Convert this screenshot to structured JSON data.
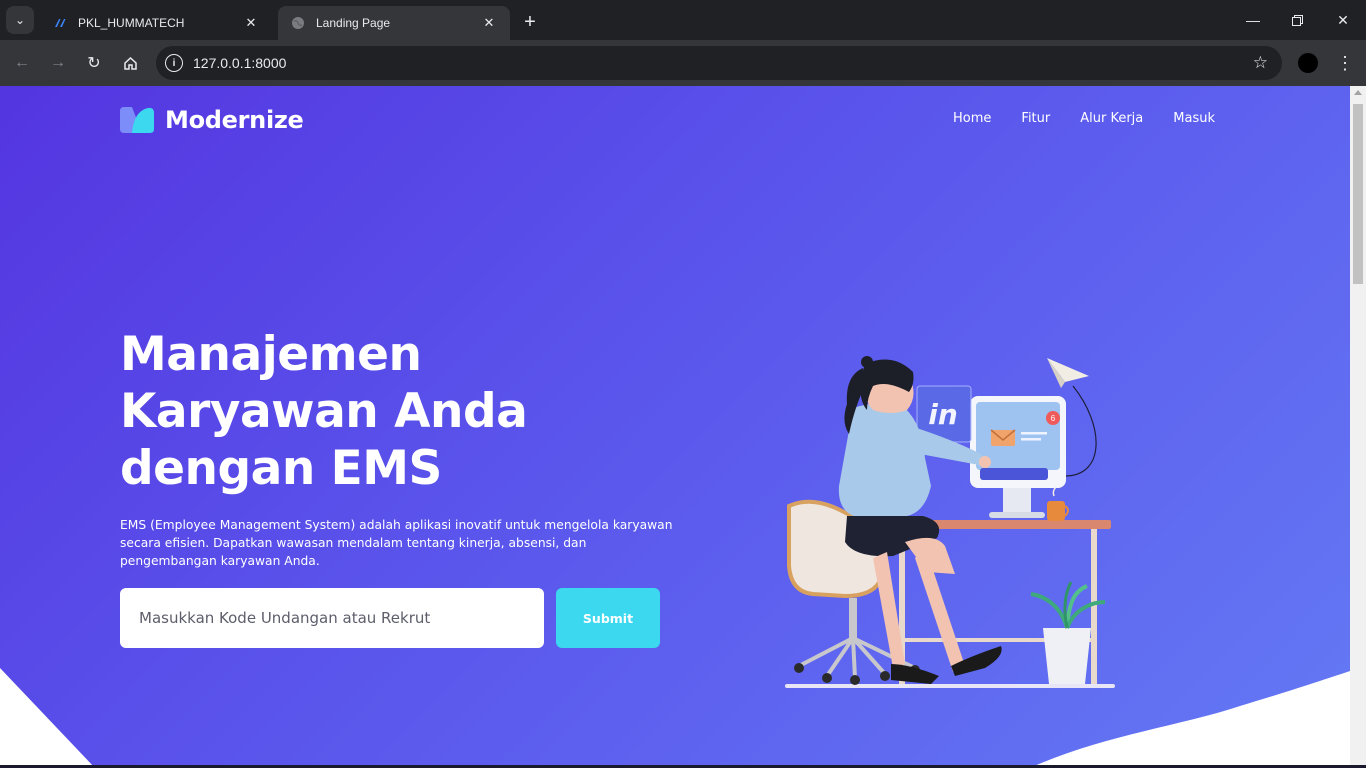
{
  "browser": {
    "tabs": [
      {
        "title": "PKL_HUMMATECH",
        "favicon": "hummatech-icon",
        "active": false
      },
      {
        "title": "Landing Page",
        "favicon": "globe-icon",
        "active": true
      }
    ],
    "url": "127.0.0.1:8000"
  },
  "page": {
    "brand": "Modernize",
    "nav": [
      "Home",
      "Fitur",
      "Alur Kerja",
      "Masuk"
    ],
    "headline": "Manajemen Karyawan Anda dengan EMS",
    "description": "EMS (Employee Management System) adalah aplikasi inovatif untuk mengelola karyawan secara efisien. Dapatkan wawasan mendalam tentang kinerja, absensi, dan pengembangan karyawan Anda.",
    "invite_placeholder": "Masukkan Kode Undangan atau Rekrut",
    "submit_label": "Submit",
    "illustration": {
      "linkedin_text": "in",
      "notification_count": "6"
    }
  },
  "colors": {
    "hero_start": "#5435e0",
    "hero_end": "#6479f4",
    "accent": "#3bd8ef"
  }
}
